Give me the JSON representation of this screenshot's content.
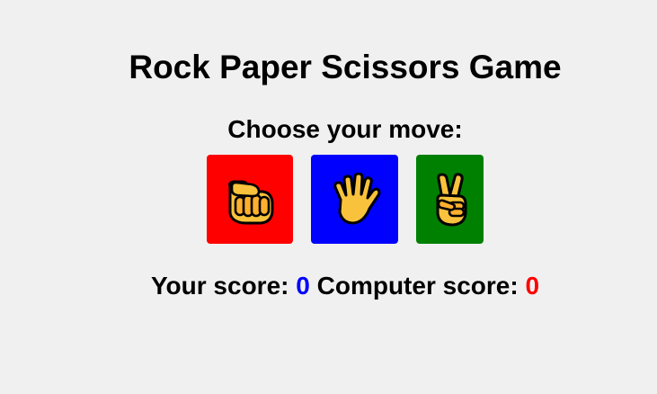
{
  "title": "Rock Paper Scissors Game",
  "prompt": "Choose your move:",
  "moves": [
    {
      "name": "rock",
      "icon": "fist-icon",
      "color": "#ff0000"
    },
    {
      "name": "paper",
      "icon": "raised-hand-icon",
      "color": "#0000ff"
    },
    {
      "name": "scissors",
      "icon": "victory-hand-icon",
      "color": "#008000"
    }
  ],
  "scores": {
    "player_label": "Your score:",
    "player_value": "0",
    "player_color": "#0000ff",
    "computer_label": "Computer score:",
    "computer_value": "0",
    "computer_color": "#ff0000"
  }
}
